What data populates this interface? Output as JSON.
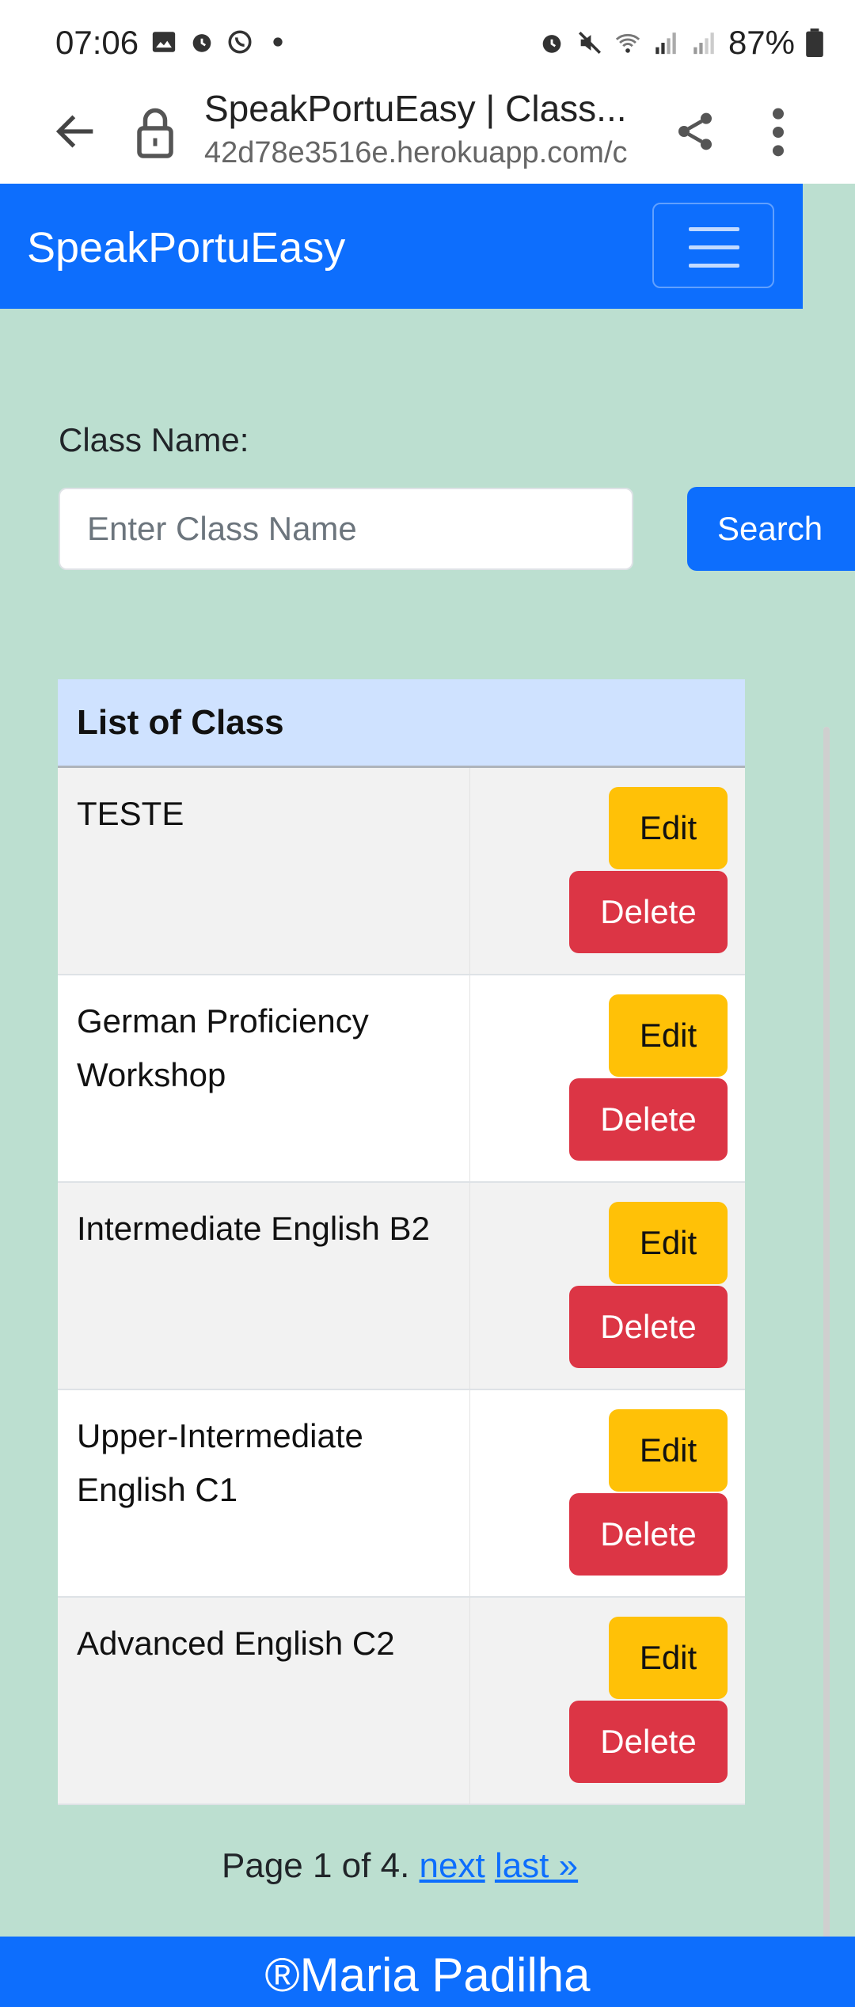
{
  "status_bar": {
    "time": "07:06",
    "battery": "87%",
    "icons_left": [
      "image-icon",
      "alarm-icon",
      "whatsapp-icon",
      "dot-icon"
    ],
    "icons_right": [
      "alarm-icon",
      "mute-icon",
      "wifi-icon",
      "signal-icon",
      "signal-r-icon",
      "battery-icon"
    ]
  },
  "browser": {
    "page_title": "SpeakPortuEasy | Class...",
    "url": "42d78e3516e.herokuapp.com/c"
  },
  "navbar": {
    "brand": "SpeakPortuEasy"
  },
  "search": {
    "label": "Class Name:",
    "placeholder": "Enter Class Name",
    "value": "",
    "button_label": "Search"
  },
  "table": {
    "header": "List of Class",
    "edit_label": "Edit",
    "delete_label": "Delete",
    "rows": [
      {
        "name": "TESTE"
      },
      {
        "name": "German Proficiency Workshop"
      },
      {
        "name": "Intermediate English B2"
      },
      {
        "name": "Upper-Intermediate English C1"
      },
      {
        "name": "Advanced English C2"
      }
    ]
  },
  "pagination": {
    "text": "Page 1 of 4.",
    "next_label": "next",
    "last_label": "last »"
  },
  "footer": {
    "text": "®Maria Padilha"
  },
  "colors": {
    "primary": "#0d6efd",
    "page_background": "#bcdfd0",
    "edit": "#ffc107",
    "delete": "#dc3545",
    "table_header": "#cfe2ff"
  }
}
